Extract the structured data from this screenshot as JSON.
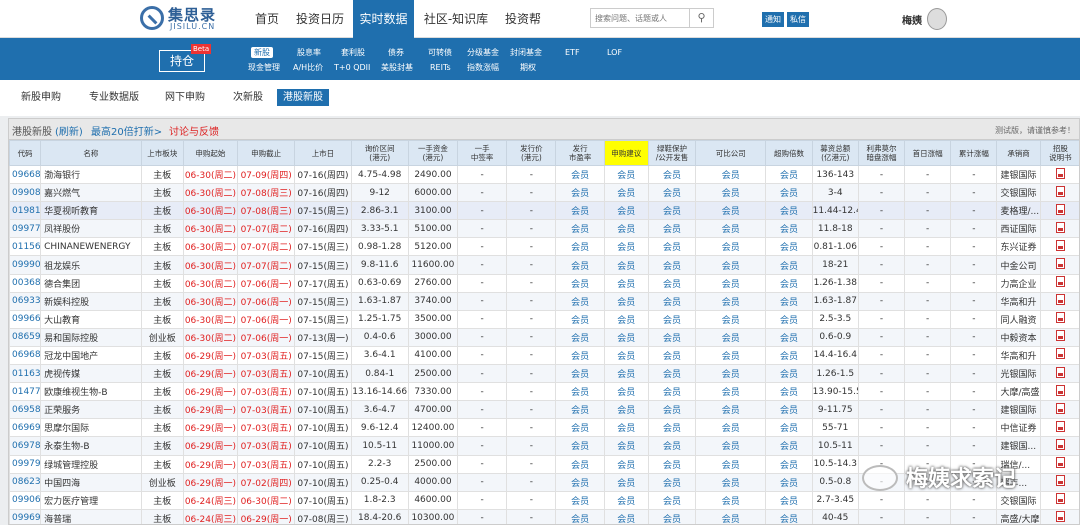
{
  "site": {
    "logo_cn": "集思录",
    "logo_en": "JISILU.CN"
  },
  "topnav": [
    "首页",
    "投资日历",
    "实时数据",
    "社区-知识库",
    "投资帮"
  ],
  "search": {
    "placeholder": "搜索问题、话题或人"
  },
  "top_buttons": [
    "通知",
    "私信"
  ],
  "user": {
    "name": "梅姨"
  },
  "hold": {
    "label": "持仓",
    "badge": "Beta"
  },
  "blue_nav": {
    "row1": [
      "新股",
      "股息率",
      "套利股",
      "债券",
      "可转债",
      "分级基金",
      "封闭基金",
      "ETF",
      "LOF"
    ],
    "row2": [
      "现金管理",
      "A/H比价",
      "T+0 QDII",
      "美股封基",
      "REITs",
      "指数涨幅",
      "期权"
    ]
  },
  "subtabs": [
    "新股申购",
    "专业数据版",
    "网下申购",
    "次新股",
    "港股新股"
  ],
  "panel": {
    "title": "港股新股",
    "refresh": "(刷新)",
    "more": "最高20倍打新>",
    "discuss": "讨论与反馈",
    "note": "测试版，请谨慎参考！"
  },
  "columns": [
    "代码",
    "名称",
    "上市板块",
    "申购起始",
    "申购截止",
    "上市日",
    "询价区间\n(港元)",
    "一手资金\n(港元)",
    "一手\n中签率",
    "发行价\n(港元)",
    "发行\n市盈率",
    "申购建议",
    "绿鞋保护\n/公开发售",
    "可比公司",
    "超购倍数",
    "募资总额\n(亿港元)",
    "利弗莫尔\n暗盘涨幅",
    "首日涨幅",
    "累计涨幅",
    "承销商",
    "招股\n说明书"
  ],
  "rows": [
    [
      "09668",
      "渤海银行",
      "主板",
      "06-30(周二)",
      "07-09(周四)",
      "07-16(周四)",
      "4.75-4.98",
      "2490.00",
      "-",
      "-",
      "会员",
      "会员",
      "会员",
      "会员",
      "会员",
      "136-143",
      "-",
      "-",
      "-",
      "建银国际"
    ],
    [
      "09908",
      "嘉兴燃气",
      "主板",
      "06-30(周二)",
      "07-08(周三)",
      "07-16(周四)",
      "9-12",
      "6000.00",
      "-",
      "-",
      "会员",
      "会员",
      "会员",
      "会员",
      "会员",
      "3-4",
      "-",
      "-",
      "-",
      "交银国际"
    ],
    [
      "01981",
      "华夏视听教育",
      "主板",
      "06-30(周二)",
      "07-08(周三)",
      "07-15(周三)",
      "2.86-3.1",
      "3100.00",
      "-",
      "-",
      "会员",
      "会员",
      "会员",
      "会员",
      "会员",
      "11.44-12.4",
      "-",
      "-",
      "-",
      "麦格理/..."
    ],
    [
      "09977",
      "凤祥股份",
      "主板",
      "06-30(周二)",
      "07-07(周二)",
      "07-16(周四)",
      "3.33-5.1",
      "5100.00",
      "-",
      "-",
      "会员",
      "会员",
      "会员",
      "会员",
      "会员",
      "11.8-18",
      "-",
      "-",
      "-",
      "西证国际"
    ],
    [
      "01156",
      "CHINANEWENERGY",
      "主板",
      "06-30(周二)",
      "07-07(周二)",
      "07-15(周三)",
      "0.98-1.28",
      "5120.00",
      "-",
      "-",
      "会员",
      "会员",
      "会员",
      "会员",
      "会员",
      "0.81-1.06",
      "-",
      "-",
      "-",
      "东兴证券"
    ],
    [
      "09990",
      "祖龙娱乐",
      "主板",
      "06-30(周二)",
      "07-07(周二)",
      "07-15(周三)",
      "9.8-11.6",
      "11600.00",
      "-",
      "-",
      "会员",
      "会员",
      "会员",
      "会员",
      "会员",
      "18-21",
      "-",
      "-",
      "-",
      "中金公司"
    ],
    [
      "00368",
      "德合集团",
      "主板",
      "06-30(周二)",
      "07-06(周一)",
      "07-17(周五)",
      "0.63-0.69",
      "2760.00",
      "-",
      "-",
      "会员",
      "会员",
      "会员",
      "会员",
      "会员",
      "1.26-1.38",
      "-",
      "-",
      "-",
      "力高企业"
    ],
    [
      "06933",
      "新娱科控股",
      "主板",
      "06-30(周二)",
      "07-06(周一)",
      "07-15(周三)",
      "1.63-1.87",
      "3740.00",
      "-",
      "-",
      "会员",
      "会员",
      "会员",
      "会员",
      "会员",
      "1.63-1.87",
      "-",
      "-",
      "-",
      "华高和升"
    ],
    [
      "09966",
      "大山教育",
      "主板",
      "06-30(周二)",
      "07-06(周一)",
      "07-15(周三)",
      "1.25-1.75",
      "3500.00",
      "-",
      "-",
      "会员",
      "会员",
      "会员",
      "会员",
      "会员",
      "2.5-3.5",
      "-",
      "-",
      "-",
      "同人融资"
    ],
    [
      "08659",
      "易和国际控股",
      "创业板",
      "06-30(周二)",
      "07-06(周一)",
      "07-13(周一)",
      "0.4-0.6",
      "3000.00",
      "-",
      "-",
      "会员",
      "会员",
      "会员",
      "会员",
      "会员",
      "0.6-0.9",
      "-",
      "-",
      "-",
      "中毅资本"
    ],
    [
      "06968",
      "冠龙中国地产",
      "主板",
      "06-29(周一)",
      "07-03(周五)",
      "07-15(周三)",
      "3.6-4.1",
      "4100.00",
      "-",
      "-",
      "会员",
      "会员",
      "会员",
      "会员",
      "会员",
      "14.4-16.4",
      "-",
      "-",
      "-",
      "华高和升"
    ],
    [
      "01163",
      "虎视传媒",
      "主板",
      "06-29(周一)",
      "07-03(周五)",
      "07-10(周五)",
      "0.84-1",
      "2500.00",
      "-",
      "-",
      "会员",
      "会员",
      "会员",
      "会员",
      "会员",
      "1.26-1.5",
      "-",
      "-",
      "-",
      "光银国际"
    ],
    [
      "01477",
      "欧康维视生物-B",
      "主板",
      "06-29(周一)",
      "07-03(周五)",
      "07-10(周五)",
      "13.16-14.66",
      "7330.00",
      "-",
      "-",
      "会员",
      "会员",
      "会员",
      "会员",
      "会员",
      "13.90-15.5",
      "-",
      "-",
      "-",
      "大摩/高盛"
    ],
    [
      "06958",
      "正荣服务",
      "主板",
      "06-29(周一)",
      "07-03(周五)",
      "07-10(周五)",
      "3.6-4.7",
      "4700.00",
      "-",
      "-",
      "会员",
      "会员",
      "会员",
      "会员",
      "会员",
      "9-11.75",
      "-",
      "-",
      "-",
      "建银国际"
    ],
    [
      "06969",
      "思摩尔国际",
      "主板",
      "06-29(周一)",
      "07-03(周五)",
      "07-10(周五)",
      "9.6-12.4",
      "12400.00",
      "-",
      "-",
      "会员",
      "会员",
      "会员",
      "会员",
      "会员",
      "55-71",
      "-",
      "-",
      "-",
      "中信证券"
    ],
    [
      "06978",
      "永泰生物-B",
      "主板",
      "06-29(周一)",
      "07-03(周五)",
      "07-10(周五)",
      "10.5-11",
      "11000.00",
      "-",
      "-",
      "会员",
      "会员",
      "会员",
      "会员",
      "会员",
      "10.5-11",
      "-",
      "-",
      "-",
      "建银国..."
    ],
    [
      "09979",
      "绿城管理控股",
      "主板",
      "06-29(周一)",
      "07-03(周五)",
      "07-10(周五)",
      "2.2-3",
      "2500.00",
      "-",
      "-",
      "会员",
      "会员",
      "会员",
      "会员",
      "会员",
      "10.5-14.3",
      "-",
      "-",
      "-",
      "瑞信/..."
    ],
    [
      "08623",
      "中国四海",
      "创业板",
      "06-29(周一)",
      "07-02(周四)",
      "07-10(周五)",
      "0.25-0.4",
      "4000.00",
      "-",
      "-",
      "会员",
      "会员",
      "会员",
      "会员",
      "会员",
      "0.5-0.8",
      "-",
      "-",
      "-",
      "瑞丰..."
    ],
    [
      "09906",
      "宏力医疗管理",
      "主板",
      "06-24(周三)",
      "06-30(周二)",
      "07-10(周五)",
      "1.8-2.3",
      "4600.00",
      "-",
      "-",
      "会员",
      "会员",
      "会员",
      "会员",
      "会员",
      "2.7-3.45",
      "-",
      "-",
      "-",
      "交银国际"
    ],
    [
      "09969",
      "海普瑞",
      "主板",
      "06-24(周三)",
      "06-29(周一)",
      "07-08(周三)",
      "18.4-20.6",
      "10300.00",
      "-",
      "-",
      "会员",
      "会员",
      "会员",
      "会员",
      "会员",
      "40-45",
      "-",
      "-",
      "-",
      "高盛/大摩"
    ]
  ],
  "watermark": {
    "text": "梅姨求索记"
  }
}
